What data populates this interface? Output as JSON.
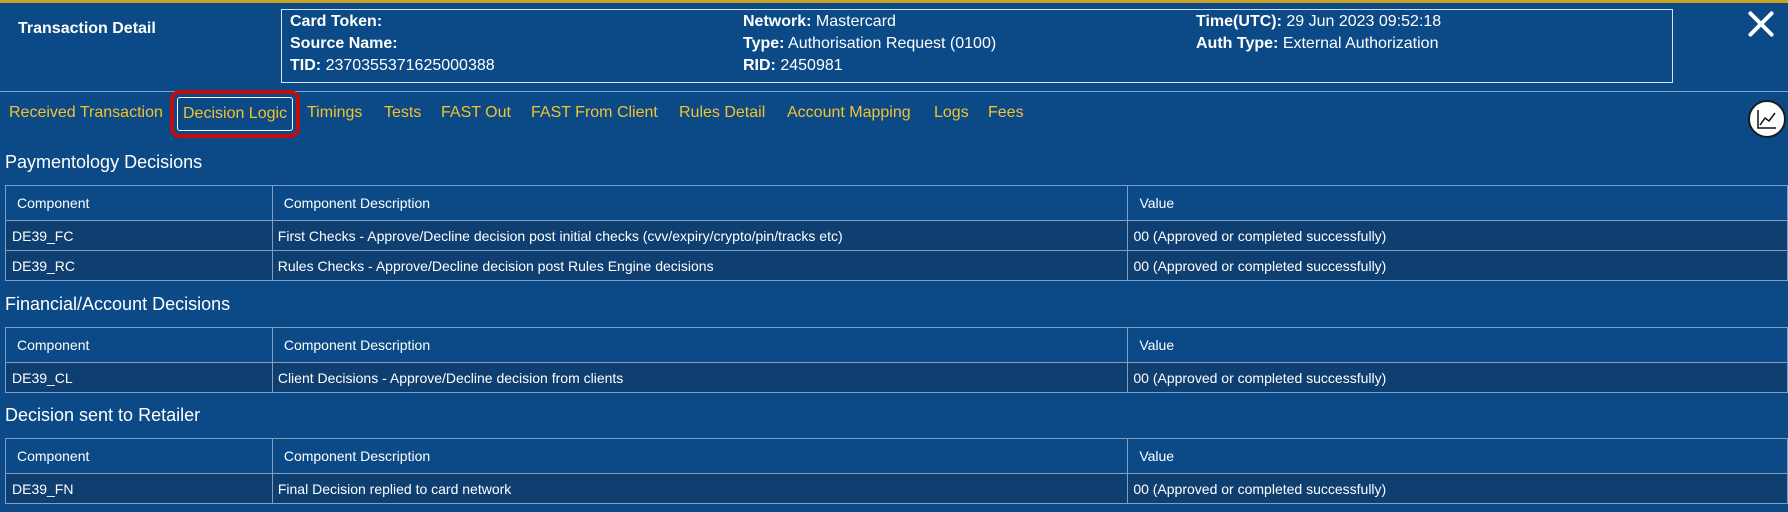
{
  "header": {
    "title": "Transaction Detail",
    "fields": {
      "card_token_label": "Card Token:",
      "card_token_value": "",
      "source_name_label": "Source Name:",
      "source_name_value": "",
      "tid_label": "TID:",
      "tid_value": "2370355371625000388",
      "network_label": "Network:",
      "network_value": "Mastercard",
      "type_label": "Type:",
      "type_value": "Authorisation Request (0100)",
      "rid_label": "RID:",
      "rid_value": "2450981",
      "time_label": "Time(UTC):",
      "time_value": "29 Jun 2023 09:52:18",
      "auth_type_label": "Auth Type:",
      "auth_type_value": "External Authorization"
    }
  },
  "tabs": [
    {
      "label": "Received Transaction"
    },
    {
      "label": "Decision Logic",
      "active": true
    },
    {
      "label": "Timings"
    },
    {
      "label": "Tests"
    },
    {
      "label": "FAST Out"
    },
    {
      "label": "FAST From Client"
    },
    {
      "label": "Rules Detail"
    },
    {
      "label": "Account Mapping"
    },
    {
      "label": "Logs"
    },
    {
      "label": "Fees"
    }
  ],
  "icons": {
    "close": "close-icon",
    "chart": "line-chart-icon"
  },
  "colors": {
    "background": "#0b4a86",
    "tab_text": "#f2c230",
    "highlight": "#c00d0d",
    "row": "#0e3f70"
  },
  "sections": [
    {
      "title": "Paymentology Decisions",
      "headers": [
        "Component",
        "Component Description",
        "Value"
      ],
      "rows": [
        [
          "DE39_FC",
          "First Checks - Approve/Decline decision post initial checks (cvv/expiry/crypto/pin/tracks etc)",
          "00 (Approved or completed successfully)"
        ],
        [
          "DE39_RC",
          "Rules Checks - Approve/Decline decision post Rules Engine decisions",
          "00 (Approved or completed successfully)"
        ]
      ]
    },
    {
      "title": "Financial/Account Decisions",
      "headers": [
        "Component",
        "Component Description",
        "Value"
      ],
      "rows": [
        [
          "DE39_CL",
          "Client Decisions - Approve/Decline decision from clients",
          "00 (Approved or completed successfully)"
        ]
      ]
    },
    {
      "title": "Decision sent to Retailer",
      "headers": [
        "Component",
        "Component Description",
        "Value"
      ],
      "rows": [
        [
          "DE39_FN",
          "Final Decision replied to card network",
          "00 (Approved or completed successfully)"
        ]
      ]
    }
  ]
}
